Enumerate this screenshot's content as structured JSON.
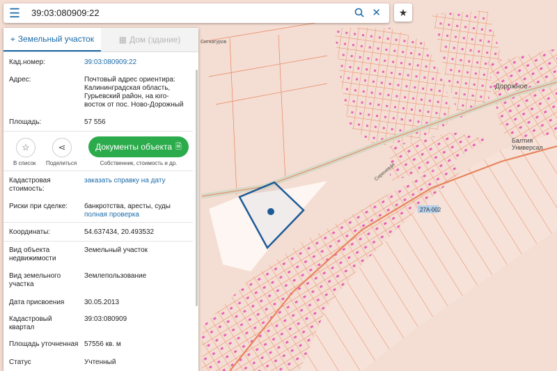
{
  "search": {
    "value": "39:03:080909:22",
    "menu_icon": "menu-icon",
    "search_icon": "search-icon",
    "clear_icon": "close-icon",
    "fav_icon": "star-icon"
  },
  "tabs": [
    {
      "label": "Земельный участок",
      "icon": "land-pin-icon",
      "active": true
    },
    {
      "label": "Дом (здание)",
      "icon": "building-icon",
      "active": false
    }
  ],
  "info": {
    "cad_label": "Кад.номер:",
    "cad_value": "39:03:080909:22",
    "addr_label": "Адрес:",
    "addr_lines": [
      "Почтовый адрес ориентира:",
      "Калининградская область,",
      "Гурьевский район, на юго-",
      "восток от пос. Ново-Дорожный"
    ],
    "area_label": "Площадь:",
    "area_value": "57 556"
  },
  "actions": {
    "save_label": "В список",
    "share_label": "Поделиться",
    "docs_label": "Документы объекта",
    "docs_sub": "Собственник, стоимость и др."
  },
  "details": {
    "cost_label_1": "Кадастровая",
    "cost_label_2": "стоимость:",
    "cost_link": "заказать справку на дату",
    "risk_label": "Риски при сделке:",
    "risk_value": "банкротства, аресты, суды",
    "risk_link": "полная проверка",
    "coords_label": "Координаты:",
    "coords_value": "54.637434, 20.493532",
    "type_label_1": "Вид объекта",
    "type_label_2": "недвижимости",
    "type_value": "Земельный участок",
    "kind_label_1": "Вид земельного",
    "kind_label_2": "участка",
    "kind_value": "Землепользование",
    "date_label": "Дата присвоения",
    "date_value": "30.05.2013",
    "quarter_label_1": "Кадастровый",
    "quarter_label_2": "квартал",
    "quarter_value": "39:03:080909",
    "precise_label": "Площадь уточненная",
    "precise_value": "57556 кв. м",
    "status_label": "Статус",
    "status_value": "Учтенный"
  },
  "map": {
    "labels": {
      "village": "Дорожное",
      "shop_1": "Балтия",
      "shop_2": "Универсал",
      "road": "27А-002",
      "street_1": "Сиреневая",
      "street_2": "Сигнатуров"
    },
    "colors": {
      "background": "#f4ddd2",
      "parcel_line": "#e8845f",
      "parcel_fill": "#e64cb4",
      "selected": "#1d5a96",
      "road": "#d6d8c6"
    }
  }
}
